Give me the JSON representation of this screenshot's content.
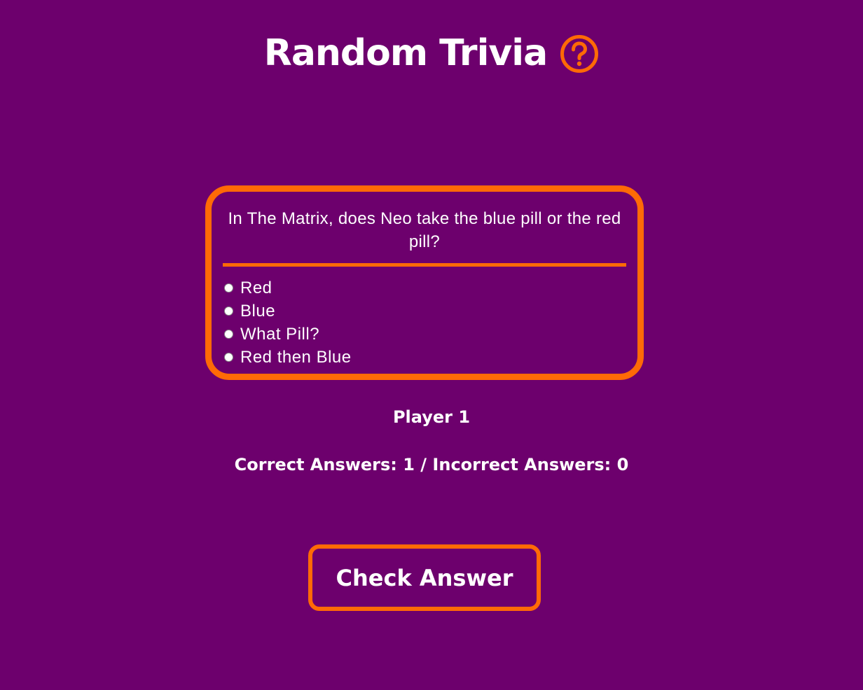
{
  "header": {
    "title": "Random Trivia",
    "help_icon": "question-circle-icon"
  },
  "quiz": {
    "question": "In The Matrix, does Neo take the blue pill or the red pill?",
    "options": [
      {
        "label": "Red",
        "selected": false
      },
      {
        "label": "Blue",
        "selected": false
      },
      {
        "label": "What Pill?",
        "selected": false
      },
      {
        "label": "Red then Blue",
        "selected": false
      }
    ]
  },
  "status": {
    "player": "Player 1",
    "score": "Correct Answers: 1 / Incorrect Answers: 0"
  },
  "actions": {
    "check_label": "Check Answer"
  },
  "colors": {
    "background": "#6d006d",
    "accent": "#ff6a06",
    "text": "#ffffff"
  }
}
